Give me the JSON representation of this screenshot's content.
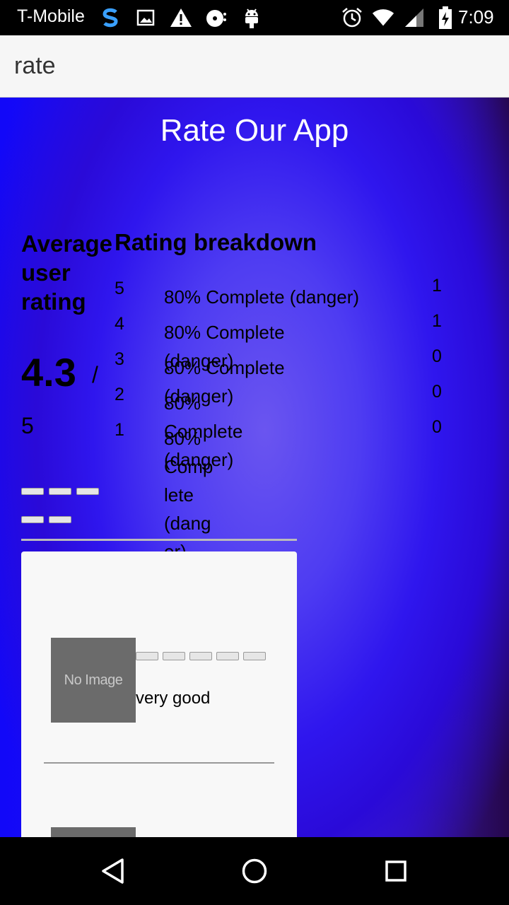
{
  "status_bar": {
    "carrier": "T-Mobile",
    "time": "7:09",
    "left_icons": [
      "s-logo-icon",
      "image-icon",
      "warning-icon",
      "disc-icon",
      "android-icon"
    ],
    "right_icons": [
      "alarm-icon",
      "wifi-icon",
      "signal-icon",
      "battery-icon"
    ]
  },
  "app_bar": {
    "title": "rate"
  },
  "page": {
    "heading": "Rate Our App"
  },
  "average": {
    "title": "Average user rating",
    "value": "4.3",
    "slash": "/",
    "max": "5",
    "stars_shown": 5
  },
  "breakdown": {
    "title": "Rating breakdown",
    "rows": [
      {
        "stars": "5",
        "label": "80% Complete (danger)",
        "count": "1"
      },
      {
        "stars": "4",
        "label": "80% Complete (danger)",
        "count": "1"
      },
      {
        "stars": "3",
        "label": "80% Complete (danger)",
        "count": "0"
      },
      {
        "stars": "2",
        "label": "80% Complete (danger)",
        "count": "0"
      },
      {
        "stars": "1",
        "label": "80% Complete (danger)",
        "count": "0"
      }
    ]
  },
  "reviews": [
    {
      "image_text": "No Image",
      "text": "very good"
    }
  ],
  "colors": {
    "content_bg_left": "#1208f8",
    "content_bg_right": "#25074a",
    "app_bar_bg": "#f6f6f6",
    "card_bg": "#f8f8f8"
  }
}
